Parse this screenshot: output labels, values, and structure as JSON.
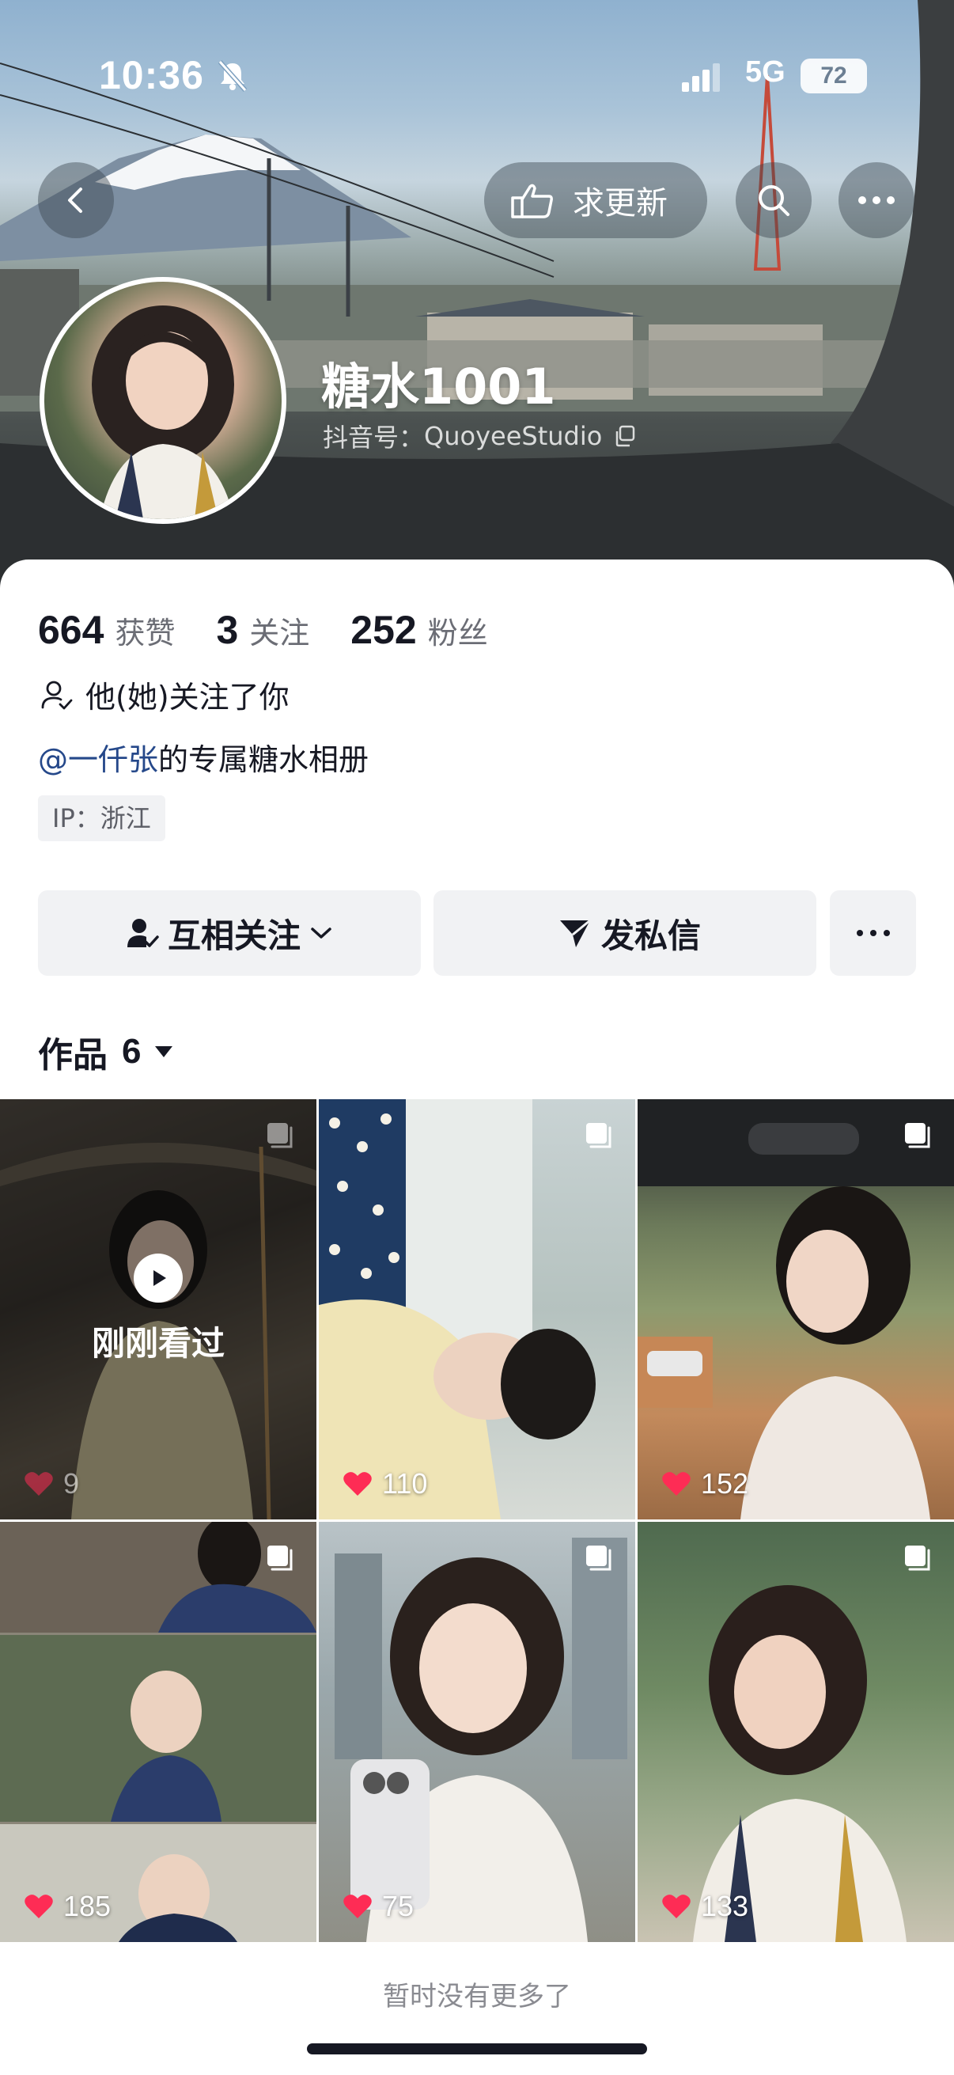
{
  "status_bar": {
    "time": "10:36",
    "network": "5G",
    "battery": "72"
  },
  "header": {
    "update_label": "求更新",
    "nickname": "糖水1001",
    "douyin_id_label": "抖音号：",
    "douyin_id": "QuoyeeStudio"
  },
  "stats": [
    {
      "value": "664",
      "label": "获赞"
    },
    {
      "value": "3",
      "label": "关注"
    },
    {
      "value": "252",
      "label": "粉丝"
    }
  ],
  "follow_note": "他(她)关注了你",
  "bio": {
    "mention": "@一仟张",
    "text": "的专属糖水相册"
  },
  "ip_tag": "IP：浙江",
  "actions": {
    "mutual_follow": "互相关注",
    "message": "发私信"
  },
  "works": {
    "label": "作品",
    "count": "6"
  },
  "tiles": [
    {
      "likes": "9",
      "watched_label": "刚刚看过"
    },
    {
      "likes": "110"
    },
    {
      "likes": "152"
    },
    {
      "likes": "185"
    },
    {
      "likes": "75"
    },
    {
      "likes": "133"
    }
  ],
  "footer": {
    "no_more": "暂时没有更多了"
  },
  "colors": {
    "like_heart": "#fe2c55",
    "mention": "#25488a",
    "button_bg": "#f1f2f4"
  }
}
